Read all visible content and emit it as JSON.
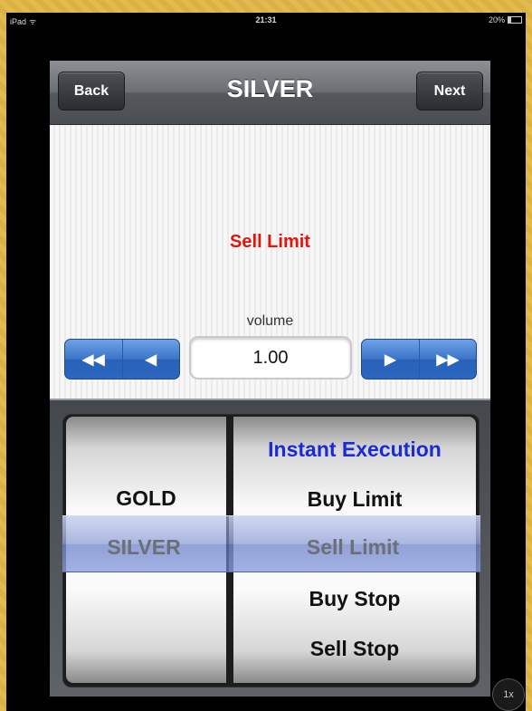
{
  "status_bar": {
    "device": "iPad",
    "time": "21:31",
    "battery": "20%"
  },
  "nav": {
    "title": "SILVER",
    "back_label": "Back",
    "next_label": "Next"
  },
  "order": {
    "type": "Sell Limit",
    "volume_label": "volume",
    "volume_value": "1.00",
    "type_color": "#e0150c"
  },
  "stepper": {
    "left": [
      {
        "icon": "fast-rewind-icon",
        "glyph": "◀◀"
      },
      {
        "icon": "step-back-icon",
        "glyph": "◀"
      }
    ],
    "right": [
      {
        "icon": "step-forward-icon",
        "glyph": "▶"
      },
      {
        "icon": "fast-forward-icon",
        "glyph": "▶▶"
      }
    ]
  },
  "picker": {
    "symbols": [
      "GOLD",
      "SILVER"
    ],
    "selected_symbol": "SILVER",
    "order_types": [
      "Instant Execution",
      "Buy Limit",
      "Sell Limit",
      "Buy Stop",
      "Sell Stop"
    ],
    "selected_order_type": "Sell Limit",
    "highlight_color": "#1a2bd6"
  },
  "zoom": {
    "label": "1x"
  }
}
